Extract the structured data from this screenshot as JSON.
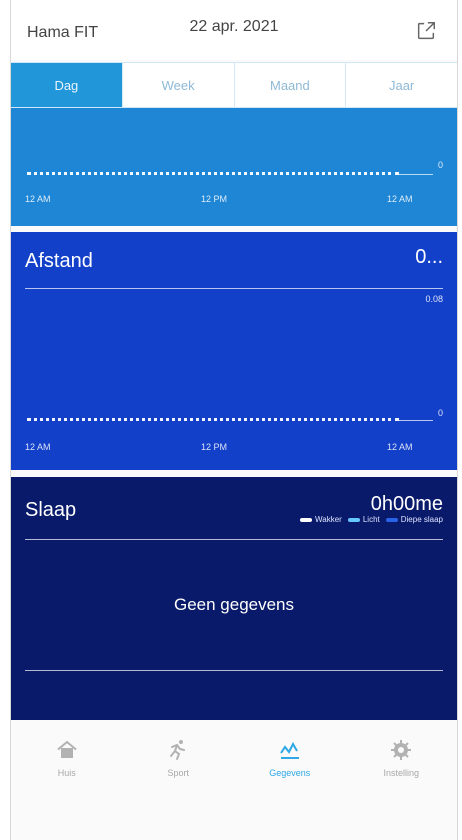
{
  "header": {
    "brand": "Hama FIT",
    "date": "22 apr. 2021"
  },
  "tabs": [
    {
      "label": "Dag",
      "active": true
    },
    {
      "label": "Week",
      "active": false
    },
    {
      "label": "Maand",
      "active": false
    },
    {
      "label": "Jaar",
      "active": false
    }
  ],
  "card1": {
    "axis_value": "0",
    "x_ticks": [
      "12 AM",
      "12 PM",
      "12 AM"
    ]
  },
  "card2": {
    "title": "Afstand",
    "value": "0...",
    "top_value": "0.08",
    "axis_value": "0",
    "x_ticks": [
      "12 AM",
      "12 PM",
      "12 AM"
    ]
  },
  "card3": {
    "title": "Slaap",
    "value": "0h00me",
    "legend": [
      {
        "label": "Wakker",
        "color": "#ffffff"
      },
      {
        "label": "Licht",
        "color": "#67c7ff"
      },
      {
        "label": "Diepe slaap",
        "color": "#2b63e8"
      }
    ],
    "no_data": "Geen gegevens"
  },
  "nav": [
    {
      "label": "Huis",
      "icon": "home-icon"
    },
    {
      "label": "Sport",
      "icon": "sport-icon"
    },
    {
      "label": "Gegevens",
      "icon": "data-icon",
      "active": true
    },
    {
      "label": "Instelling",
      "icon": "settings-icon"
    }
  ],
  "colors": {
    "tab_active": "#2196d8",
    "card_steps": "#1f86d6",
    "card_distance": "#1340c9",
    "card_sleep": "#0a1a6b",
    "nav_active": "#2ea8e6"
  }
}
